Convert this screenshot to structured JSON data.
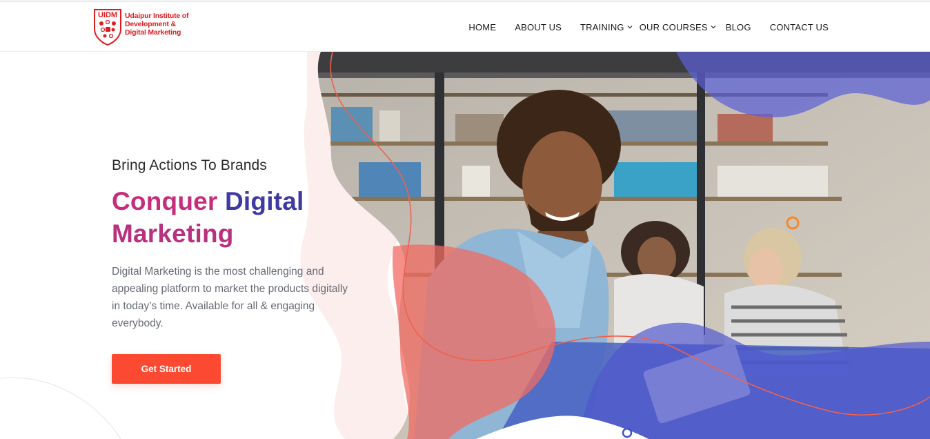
{
  "brand": {
    "logo_initials": "UIDM",
    "name_line1": "Udaipur Institute of",
    "name_line2": "Development &",
    "name_line3": "Digital Marketing",
    "color": "#e11b22"
  },
  "nav": {
    "items": [
      {
        "label": "HOME",
        "has_dropdown": false
      },
      {
        "label": "ABOUT US",
        "has_dropdown": false
      },
      {
        "label": "TRAINING",
        "has_dropdown": true
      },
      {
        "label": "OUR COURSES",
        "has_dropdown": true
      },
      {
        "label": "BLOG",
        "has_dropdown": false
      },
      {
        "label": "CONTACT US",
        "has_dropdown": false
      }
    ]
  },
  "hero": {
    "tagline": "Bring Actions To Brands",
    "headline_word1": "Conquer",
    "headline_word2": "Digital",
    "headline_word3": "Marketing",
    "description": "Digital Marketing is the most challenging and appealing platform to market the products digitally in today’s time. Available for all & engaging everybody.",
    "cta_label": "Get Started"
  },
  "colors": {
    "cta": "#fb4a31",
    "headline_pink": "#c62d7b",
    "headline_indigo": "#3f3aa3",
    "blob_pink": "#fdeeee",
    "blob_blue": "#5a5fd6",
    "blob_coral": "#f2726a"
  }
}
